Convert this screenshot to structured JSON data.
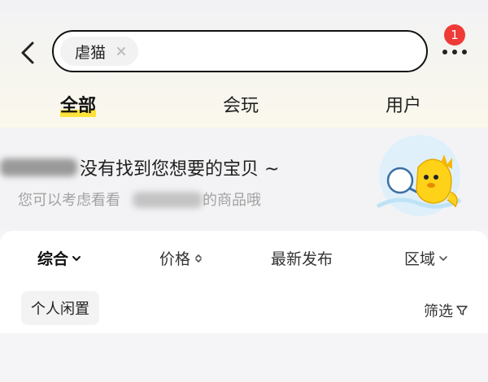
{
  "search": {
    "query": "虐猫"
  },
  "header": {
    "notification_count": "1"
  },
  "tabs": [
    {
      "label": "全部"
    },
    {
      "label": "会玩"
    },
    {
      "label": "用户"
    }
  ],
  "banner": {
    "title": "没有找到您想要的宝贝 ~",
    "subtitle_prefix": "您可以考虑看看",
    "subtitle_suffix": "的商品哦"
  },
  "filters": {
    "sort": "综合",
    "price": "价格",
    "newest": "最新发布",
    "region": "区域",
    "chip": "个人闲置",
    "filter": "筛选"
  },
  "colors": {
    "accent_yellow": "#ffe23a",
    "badge_red": "#ef3a38"
  },
  "icons": [
    "back-arrow-icon",
    "clear-icon",
    "more-icon",
    "chevron-down-icon",
    "sort-updown-icon",
    "funnel-icon",
    "mascot-illustration"
  ]
}
